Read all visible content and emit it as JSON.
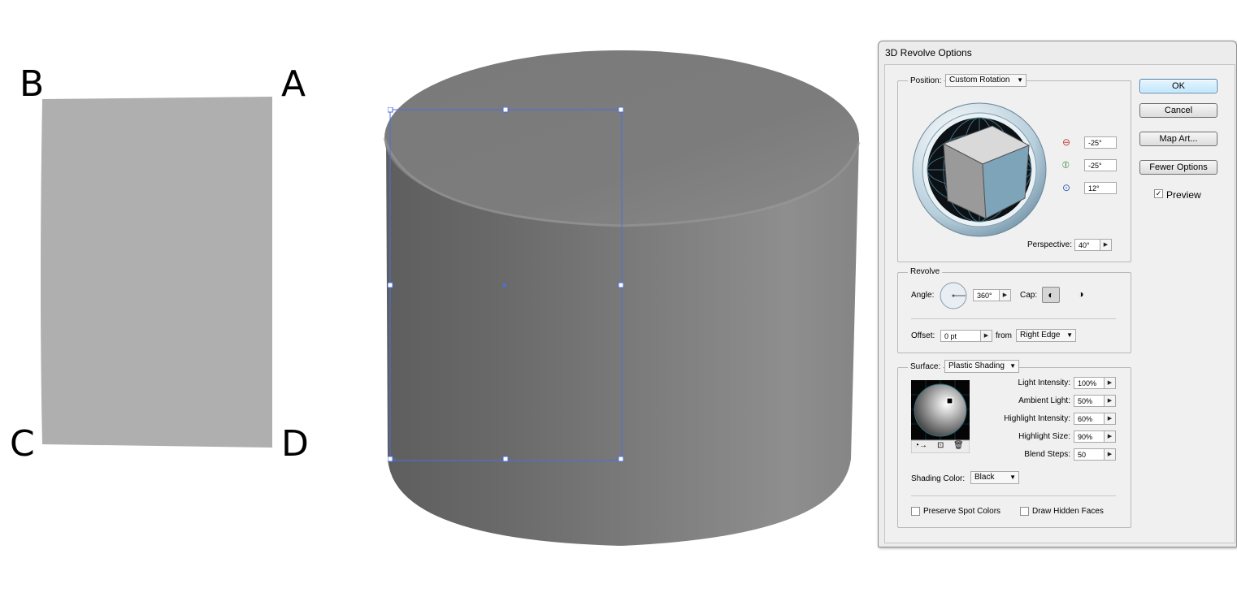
{
  "canvas": {
    "corner_labels": {
      "a": "A",
      "b": "B",
      "c": "C",
      "d": "D"
    }
  },
  "dialog": {
    "title": "3D Revolve Options",
    "buttons": {
      "ok": "OK",
      "cancel": "Cancel",
      "map_art": "Map Art...",
      "fewer_options": "Fewer Options"
    },
    "preview": {
      "label": "Preview",
      "checked": true
    },
    "position": {
      "label": "Position:",
      "value": "Custom Rotation",
      "rotate_x": "-25°",
      "rotate_y": "-25°",
      "rotate_z": "12°",
      "perspective_label": "Perspective:",
      "perspective": "40°"
    },
    "revolve": {
      "label": "Revolve",
      "angle_label": "Angle:",
      "angle": "360°",
      "cap_label": "Cap:",
      "offset_label": "Offset:",
      "offset": "0 pt",
      "from_label": "from",
      "from": "Right Edge"
    },
    "surface": {
      "label": "Surface:",
      "value": "Plastic Shading",
      "light_intensity_label": "Light Intensity:",
      "light_intensity": "100%",
      "ambient_light_label": "Ambient Light:",
      "ambient_light": "50%",
      "highlight_intensity_label": "Highlight Intensity:",
      "highlight_intensity": "60%",
      "highlight_size_label": "Highlight Size:",
      "highlight_size": "90%",
      "blend_steps_label": "Blend Steps:",
      "blend_steps": "50",
      "shading_color_label": "Shading Color:",
      "shading_color": "Black",
      "preserve_spot_colors": "Preserve Spot Colors",
      "draw_hidden_faces": "Draw Hidden Faces"
    }
  },
  "colors": {
    "selection": "#4a6fe0",
    "shape_fill": "#afafaf",
    "cube_front": "#7ea4ba"
  }
}
